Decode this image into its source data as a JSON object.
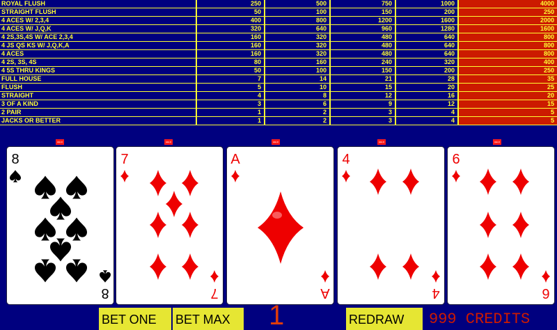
{
  "paytable": {
    "rows": [
      {
        "hand": "ROYAL FLUSH",
        "pays": [
          "250",
          "500",
          "750",
          "1000",
          "4000"
        ]
      },
      {
        "hand": "STRAIGHT FLUSH",
        "pays": [
          "50",
          "100",
          "150",
          "200",
          "250"
        ]
      },
      {
        "hand": "4 ACES W/ 2,3,4",
        "pays": [
          "400",
          "800",
          "1200",
          "1600",
          "2000"
        ]
      },
      {
        "hand": "4 ACES W/ J,Q,K",
        "pays": [
          "320",
          "640",
          "960",
          "1280",
          "1600"
        ]
      },
      {
        "hand": "4 2S,3S,4S W/ ACE 2,3,4",
        "pays": [
          "160",
          "320",
          "480",
          "640",
          "800"
        ]
      },
      {
        "hand": "4 JS QS KS W/ J,Q,K,A",
        "pays": [
          "160",
          "320",
          "480",
          "640",
          "800"
        ]
      },
      {
        "hand": "4 ACES",
        "pays": [
          "160",
          "320",
          "480",
          "640",
          "800"
        ]
      },
      {
        "hand": "4 2S, 3S, 4S",
        "pays": [
          "80",
          "160",
          "240",
          "320",
          "400"
        ]
      },
      {
        "hand": "4 5S THRU KINGS",
        "pays": [
          "50",
          "100",
          "150",
          "200",
          "250"
        ]
      },
      {
        "hand": "FULL HOUSE",
        "pays": [
          "7",
          "14",
          "21",
          "28",
          "35"
        ]
      },
      {
        "hand": "FLUSH",
        "pays": [
          "5",
          "10",
          "15",
          "20",
          "25"
        ]
      },
      {
        "hand": "STRAIGHT",
        "pays": [
          "4",
          "8",
          "12",
          "16",
          "20"
        ]
      },
      {
        "hand": "3 OF A KIND",
        "pays": [
          "3",
          "6",
          "9",
          "12",
          "15"
        ]
      },
      {
        "hand": "2 PAIR",
        "pays": [
          "1",
          "2",
          "3",
          "4",
          "5"
        ]
      },
      {
        "hand": "JACKS OR BETTER",
        "pays": [
          "1",
          "2",
          "3",
          "4",
          "5"
        ]
      }
    ]
  },
  "held_label": "HELD",
  "cards": [
    {
      "rank": "8",
      "suit": "spades",
      "color": "#000000"
    },
    {
      "rank": "7",
      "suit": "diamonds",
      "color": "#ee0000"
    },
    {
      "rank": "A",
      "suit": "diamonds",
      "color": "#ee0000"
    },
    {
      "rank": "4",
      "suit": "diamonds",
      "color": "#ee0000"
    },
    {
      "rank": "6",
      "suit": "diamonds",
      "color": "#ee0000"
    }
  ],
  "controls": {
    "bet_one": "BET ONE",
    "bet_max": "BET MAX",
    "bet_amount": "1",
    "redraw": "REDRAW",
    "credits": "999 CREDITS"
  },
  "colors": {
    "background": "#00007f",
    "paytable_text": "#ffff33",
    "selected_column": "#cc1a00",
    "button": "#e6e633",
    "held_tag": "#ff1a1a",
    "red_suit": "#ee0000"
  }
}
